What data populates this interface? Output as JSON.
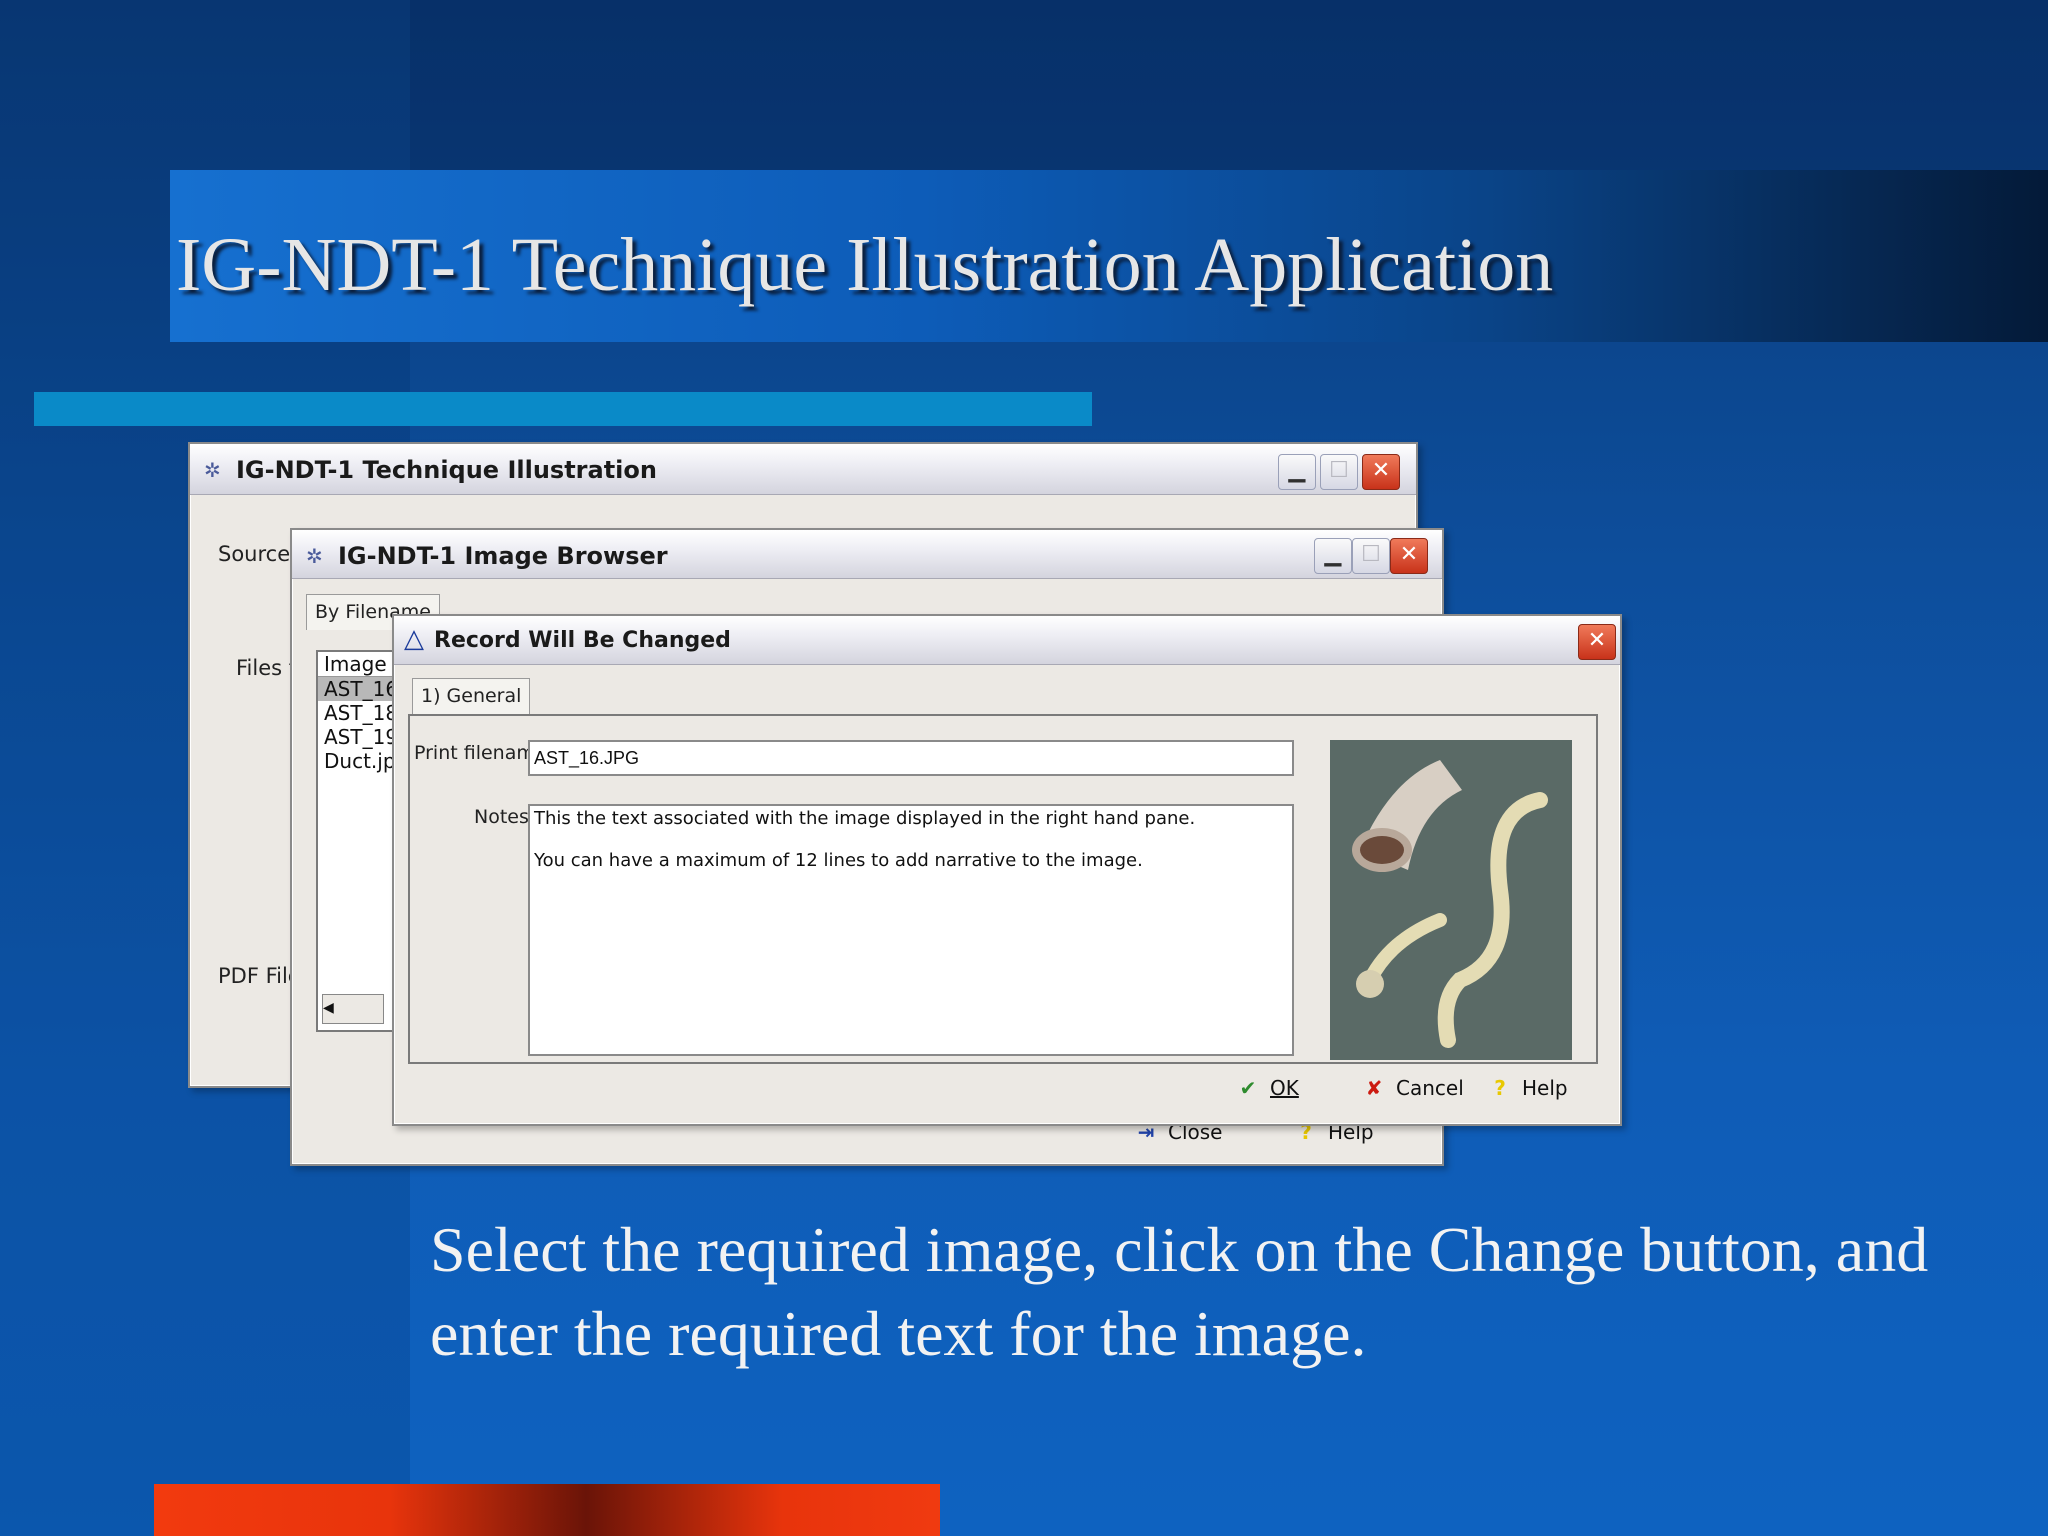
{
  "slide": {
    "title": "IG-NDT-1 Technique Illustration Application",
    "caption": "Select the required image, click on the Change button, and enter the required text for the image."
  },
  "main_window": {
    "title": "IG-NDT-1 Technique Illustration",
    "labels": {
      "source": "Source",
      "files": "Files t",
      "pdf": "PDF File"
    }
  },
  "browser_window": {
    "title": "IG-NDT-1 Image Browser",
    "tab": "By Filename",
    "list_header": "Image f",
    "files": [
      "AST_16",
      "AST_18",
      "AST_19",
      "Duct.jpg"
    ],
    "selected_index": 0,
    "buttons": {
      "close": "Close",
      "help": "Help"
    }
  },
  "dialog": {
    "title": "Record Will Be Changed",
    "tab": "1) General",
    "print_filename_label": "Print filename:",
    "print_filename_value": "AST_16.JPG",
    "notes_label": "Notes:",
    "notes_line1": "This the text associated with the image displayed in the right hand pane.",
    "notes_line2": "You can have a maximum of 12 lines to add narrative to the image.",
    "buttons": {
      "ok": "OK",
      "cancel": "Cancel",
      "help": "Help"
    }
  },
  "colors": {
    "ok_icon": "#2e8b2e",
    "cancel_icon": "#cc1a10",
    "help_icon": "#e8c800",
    "warning_icon": "#1a3a9a"
  },
  "icons": {
    "app": "gear-icon",
    "warning": "warning-icon",
    "ok": "checkmark-icon",
    "cancel": "x-icon",
    "help": "question-icon",
    "close": "door-exit-icon"
  }
}
